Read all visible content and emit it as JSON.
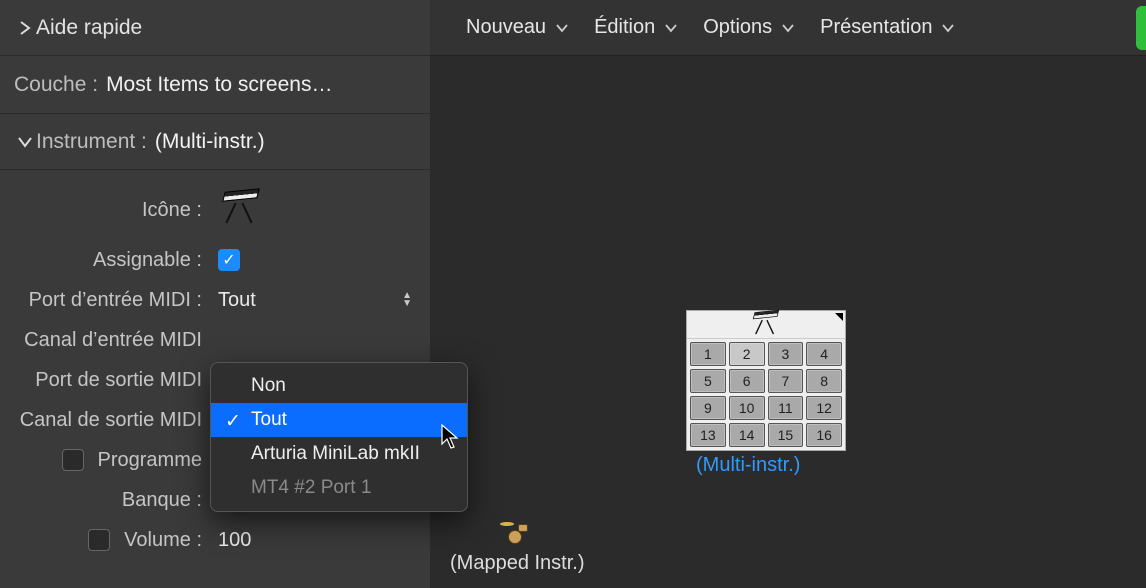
{
  "inspector": {
    "quick_help": "Aide rapide",
    "layer_label": "Couche :",
    "layer_value": "Most Items to screens…",
    "instrument_label": "Instrument :",
    "instrument_value": "(Multi-instr.)",
    "icon_label": "Icône :",
    "assignable_label": "Assignable :",
    "assignable_checked": true,
    "midi_in_port_label": "Port d’entrée MIDI :",
    "midi_in_port_value": "Tout",
    "midi_in_chan_label": "Canal d’entrée MIDI",
    "midi_out_port_label": "Port de sortie MIDI",
    "midi_out_chan_label": "Canal de sortie MIDI",
    "program_label": "Programme",
    "bank_label": "Banque :",
    "bank_value": "÷",
    "volume_label": "Volume :",
    "volume_value": "100"
  },
  "dropdown": {
    "items": [
      {
        "label": "Non",
        "selected": false,
        "disabled": false
      },
      {
        "label": "Tout",
        "selected": true,
        "disabled": false
      },
      {
        "label": "Arturia MiniLab mkII",
        "selected": false,
        "disabled": false
      },
      {
        "label": "MT4 #2 Port 1",
        "selected": false,
        "disabled": true
      }
    ]
  },
  "toolbar": {
    "new": "Nouveau",
    "edit": "Édition",
    "options": "Options",
    "presentation": "Présentation"
  },
  "canvas": {
    "multi_instr_label": "(Multi-instr.)",
    "mapped_instr_label": "(Mapped Instr.)",
    "grid_rows": [
      [
        "1",
        "2",
        "3",
        "4"
      ],
      [
        "5",
        "6",
        "7",
        "8"
      ],
      [
        "9",
        "10",
        "11",
        "12"
      ],
      [
        "13",
        "14",
        "15",
        "16"
      ]
    ],
    "lit_cell": "2"
  }
}
